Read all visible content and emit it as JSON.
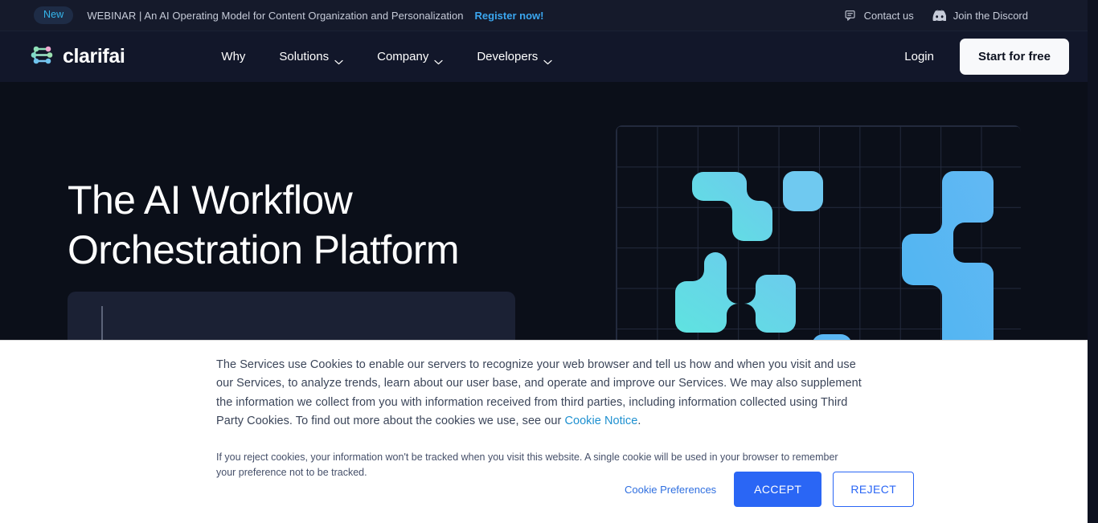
{
  "announcement": {
    "badge": "New",
    "text": "WEBINAR | An AI Operating Model for Content Organization and Personalization",
    "cta": "Register now!",
    "contact_icon": "chat-bubble-icon",
    "contact": "Contact us",
    "discord_icon": "discord-icon",
    "discord": "Join the Discord"
  },
  "nav": {
    "logo_icon": "clarifai-nodes-logo-icon",
    "brand": "clarifai",
    "items": [
      {
        "label": "Why",
        "has_chevron": false
      },
      {
        "label": "Solutions",
        "has_chevron": true
      },
      {
        "label": "Company",
        "has_chevron": true
      },
      {
        "label": "Developers",
        "has_chevron": true
      }
    ],
    "login": "Login",
    "cta": "Start for free"
  },
  "hero": {
    "title_line1": "The AI Workflow",
    "title_line2": "Orchestration Platform"
  },
  "cookie": {
    "paragraph1_a": "The Services use Cookies to enable our servers to recognize your web browser and tell us how and when you visit and use our Services, to analyze trends, learn about our user base, and operate and improve our Services. We may also supplement the information we collect from you with information received from third parties, including information collected using Third Party Cookies. To find out more about the cookies we use, see our ",
    "link": "Cookie Notice",
    "paragraph1_b": ".",
    "paragraph2": "If you reject cookies, your information won't be tracked when you visit this website. A single cookie will be used in your browser to remember your preference not to be tracked.",
    "preferences": "Cookie Preferences",
    "accept": "ACCEPT",
    "reject": "REJECT"
  },
  "colors": {
    "page_bg": "#0b0f19",
    "nav_bg": "#12172a",
    "announce_bg": "#151a2b",
    "accent_blue": "#2a66f5",
    "link_blue": "#3ba7f0",
    "cookie_link": "#1e90d0",
    "graphic_teal": "#5fe0e0",
    "graphic_blue": "#55b2f5"
  }
}
